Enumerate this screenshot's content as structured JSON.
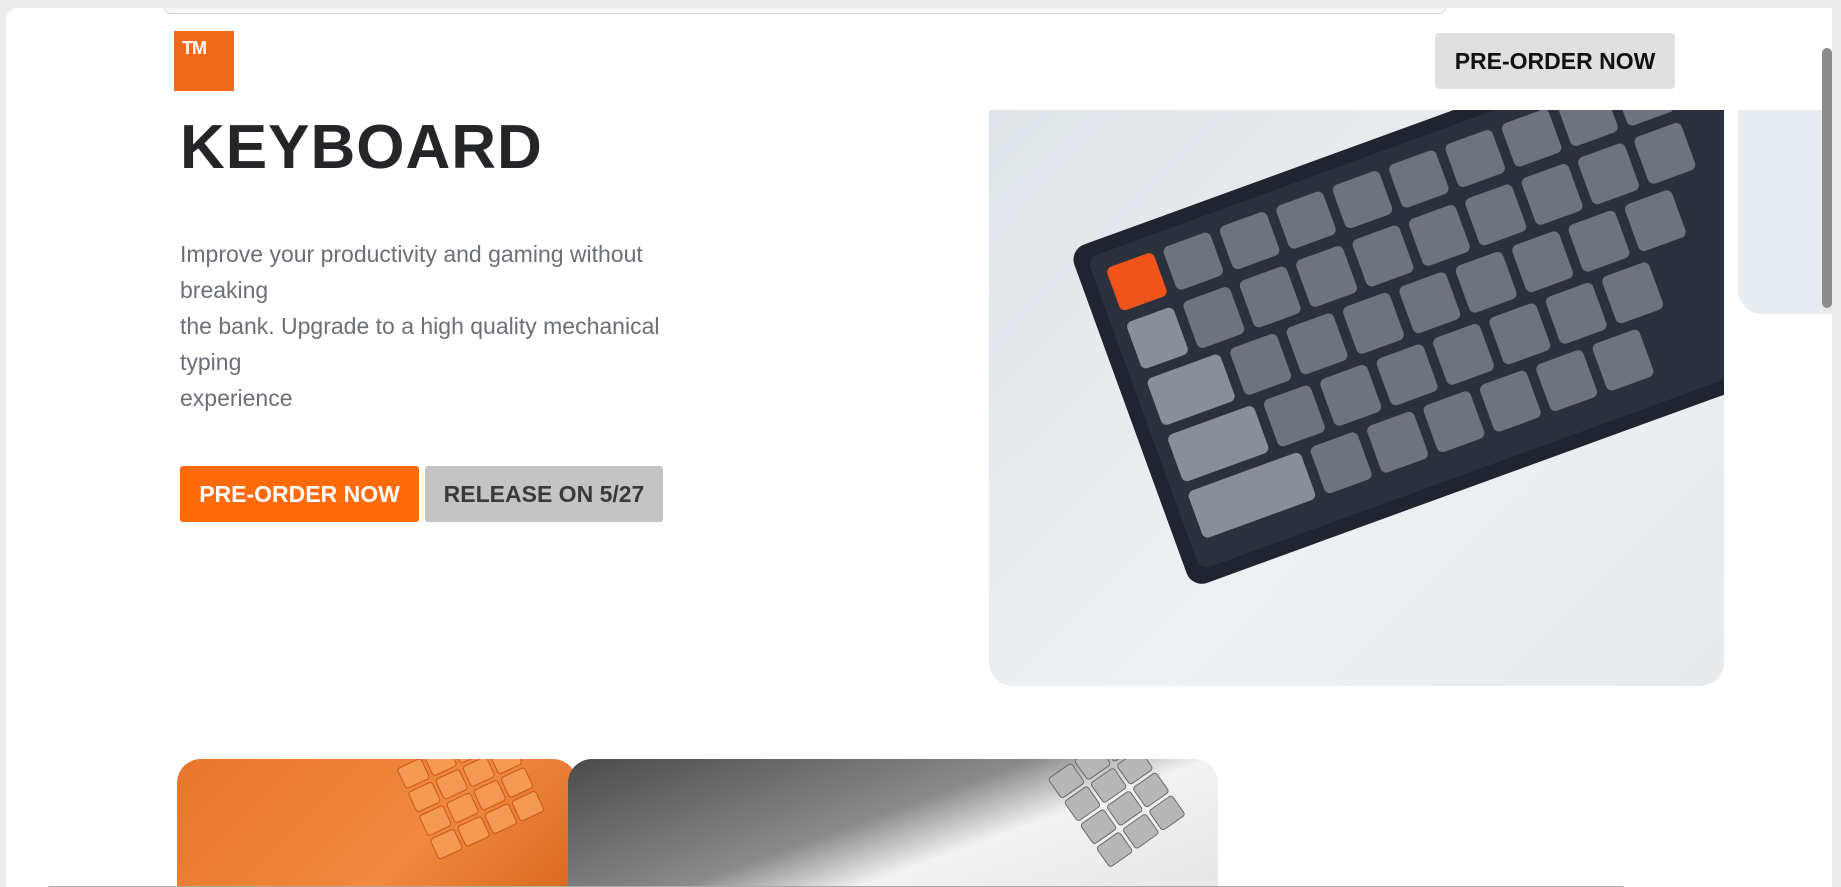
{
  "header": {
    "logo_text": "TM",
    "cta_label": "PRE-ORDER NOW"
  },
  "hero": {
    "title": "KEYBOARD",
    "description_lines": [
      "Improve your productivity and gaming without",
      "breaking",
      "the bank. Upgrade to a high quality mechanical",
      "typing",
      "experience"
    ],
    "primary_button": "PRE-ORDER NOW",
    "secondary_button": "RELEASE ON 5/27"
  },
  "colors": {
    "accent": "#ff6a0b",
    "secondary_button": "#c4c4c4",
    "header_cta": "#e0e0e0",
    "title": "#232528",
    "body_text": "#6b6f76"
  },
  "images": [
    "keyboard-hero-image",
    "orange-keyboard-thumbnail",
    "gray-keyboard-thumbnail"
  ]
}
